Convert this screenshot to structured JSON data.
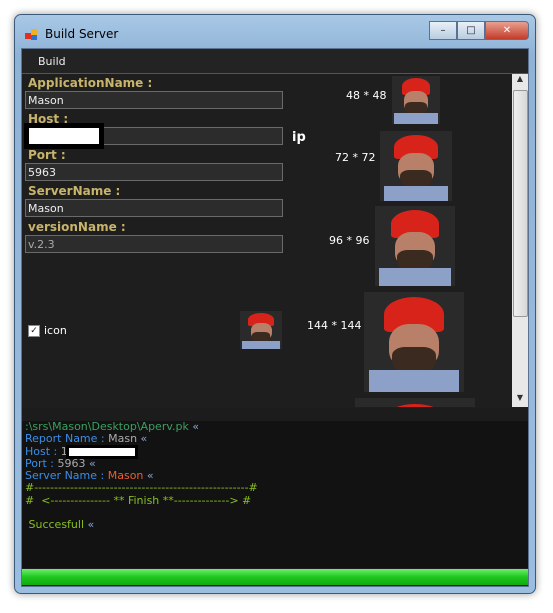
{
  "window": {
    "title": "Build Server",
    "minimize": "–",
    "maximize": "□",
    "close": "✕"
  },
  "menu": {
    "build": "Build"
  },
  "form": {
    "application_name_label": "ApplicationName :",
    "application_name": "Mason",
    "host_label": "Host :",
    "host": "",
    "ip_label": "ip",
    "port_label": "Port :",
    "port": "5963",
    "server_name_label": "ServerName :",
    "server_name": "Mason",
    "version_name_label": "versionName :",
    "version_name": "v.2.3",
    "icon_checkbox_label": "icon",
    "icon_checked": true
  },
  "icon_sizes": [
    "48 * 48",
    "72 * 72",
    "96 * 96",
    "144 * 144"
  ],
  "log": {
    "path": ":\\srs\\Mason\\Desktop\\Aperv.pk",
    "arrow": " «",
    "report_label": "Report Name : ",
    "report_value": "Masn",
    "host_label": "Host : ",
    "host_value": "19",
    "port_label": "Port : ",
    "port_value": "5963",
    "server_label": "Server Name : ",
    "server_value": "Mason",
    "sep1": "#------------------------------------------------------#",
    "sep2": "#  <--------------- ** Finish **--------------> #",
    "success": " Succesfull"
  },
  "progress": {
    "percent": 100
  },
  "colors": {
    "label": "#c8b46a",
    "log_blue": "#3a8ee6",
    "log_green": "#88c020",
    "log_orange": "#e86030",
    "progress": "#1ec81e"
  }
}
